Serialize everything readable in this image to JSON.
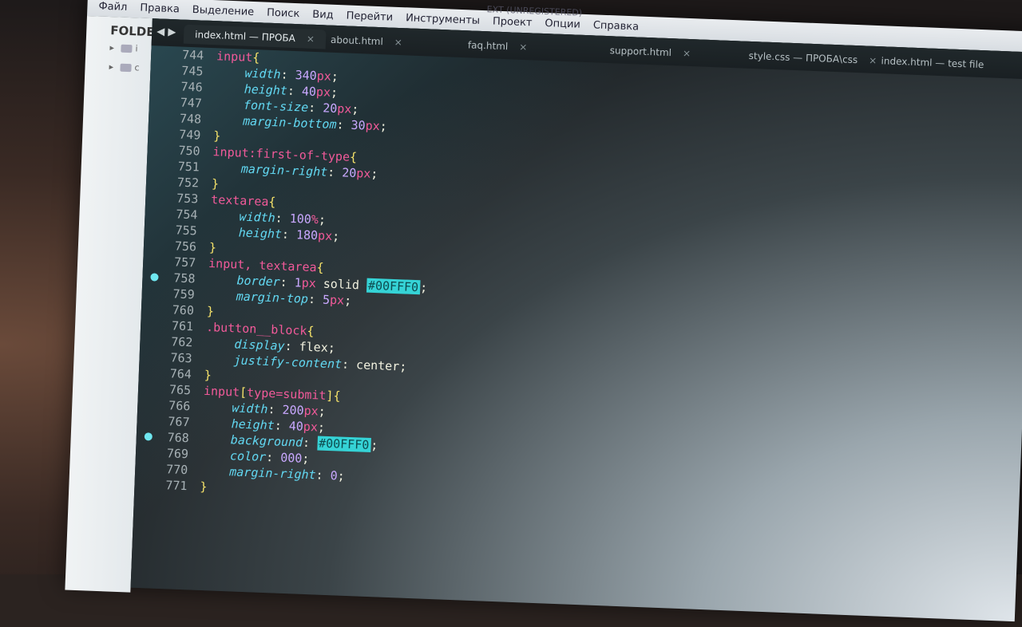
{
  "window_title": "EXT (UNREGISTERED)",
  "menu": [
    "Файл",
    "Правка",
    "Выделение",
    "Поиск",
    "Вид",
    "Перейти",
    "Инструменты",
    "Проект",
    "Опции",
    "Справка"
  ],
  "sidebar": {
    "header": "FOLDE",
    "folders": [
      {
        "label": "i"
      },
      {
        "label": "c"
      }
    ]
  },
  "tabs": [
    {
      "label": "index.html — ПРОБА",
      "active": true
    },
    {
      "label": "about.html",
      "active": false
    },
    {
      "label": "faq.html",
      "active": false
    },
    {
      "label": "support.html",
      "active": false
    },
    {
      "label": "style.css — ПРОБА\\css",
      "active": false
    },
    {
      "label": "index.html — test file",
      "active": false
    }
  ],
  "code_lines": [
    {
      "num": "744",
      "text": "input{"
    },
    {
      "num": "745",
      "text": "    width: 340px;"
    },
    {
      "num": "746",
      "text": "    height: 40px;"
    },
    {
      "num": "747",
      "text": "    font-size: 20px;"
    },
    {
      "num": "748",
      "text": "    margin-bottom: 30px;"
    },
    {
      "num": "749",
      "text": "}"
    },
    {
      "num": "750",
      "text": "input:first-of-type{"
    },
    {
      "num": "751",
      "text": "    margin-right: 20px;"
    },
    {
      "num": "752",
      "text": "}"
    },
    {
      "num": "753",
      "text": "textarea{"
    },
    {
      "num": "754",
      "text": "    width: 100%;"
    },
    {
      "num": "755",
      "text": "    height: 180px;"
    },
    {
      "num": "756",
      "text": "}"
    },
    {
      "num": "757",
      "text": "input, textarea{"
    },
    {
      "num": "758",
      "text": "    border: 1px solid #00FFF0;",
      "marker": true
    },
    {
      "num": "759",
      "text": "    margin-top: 5px;"
    },
    {
      "num": "760",
      "text": "}"
    },
    {
      "num": "761",
      "text": ".button__block{"
    },
    {
      "num": "762",
      "text": "    display: flex;"
    },
    {
      "num": "763",
      "text": "    justify-content: center;"
    },
    {
      "num": "764",
      "text": "}"
    },
    {
      "num": "765",
      "text": "input[type=submit]{"
    },
    {
      "num": "766",
      "text": "    width: 200px;"
    },
    {
      "num": "767",
      "text": "    height: 40px;"
    },
    {
      "num": "768",
      "text": "    background: #00FFF0;",
      "marker": true
    },
    {
      "num": "769",
      "text": "    color: 000;"
    },
    {
      "num": "770",
      "text": "    margin-right: 0;"
    },
    {
      "num": "771",
      "text": "}"
    }
  ],
  "colors": {
    "accent": "#00FFF0",
    "selector": "#f25a9a",
    "property": "#62d8f2",
    "number": "#c9a8ff"
  }
}
